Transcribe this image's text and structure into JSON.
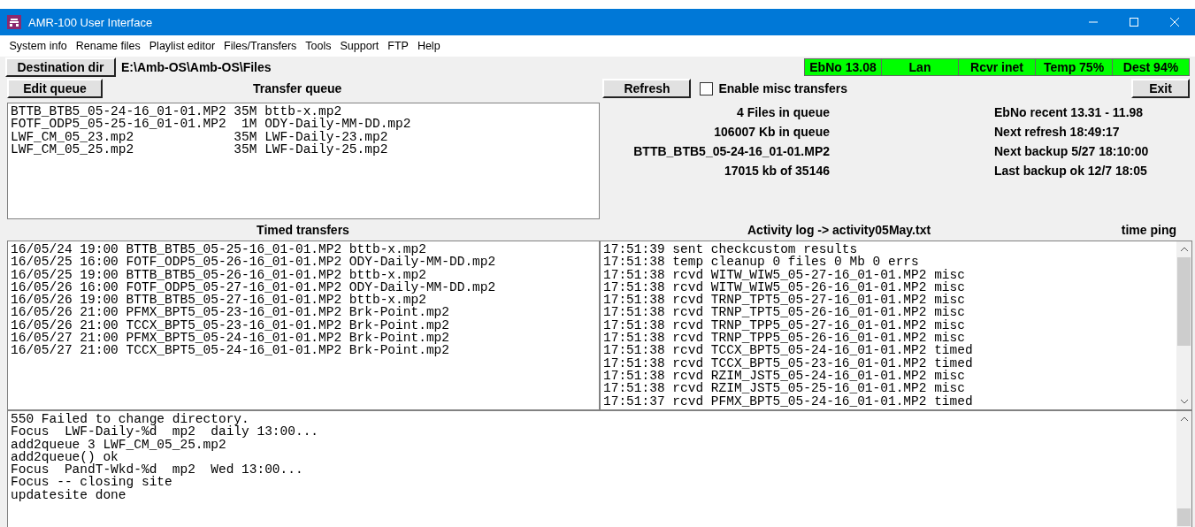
{
  "window": {
    "title": "AMR-100 User Interface"
  },
  "menu": [
    "System info",
    "Rename files",
    "Playlist editor",
    "Files/Transfers",
    "Tools",
    "Support",
    "FTP",
    "Help"
  ],
  "destination": {
    "button": "Destination dir",
    "path": "E:\\Amb-OS\\Amb-OS\\Files"
  },
  "status_bar": [
    "EbNo 13.08",
    "Lan",
    "Rcvr inet",
    "Temp 75%",
    "Dest 94%"
  ],
  "edit_queue_button": "Edit queue",
  "transfer_queue": {
    "title": "Transfer queue",
    "lines": [
      "BTTB_BTB5_05-24-16_01-01.MP2 35M bttb-x.mp2",
      "FOTF_ODP5_05-25-16_01-01.MP2  1M ODY-Daily-MM-DD.mp2",
      "LWF_CM_05_23.mp2             35M LWF-Daily-23.mp2",
      "LWF_CM_05_25.mp2             35M LWF-Daily-25.mp2"
    ]
  },
  "refresh_button": "Refresh",
  "misc_checkbox": {
    "label": "Enable misc transfers",
    "checked": false
  },
  "exit_button": "Exit",
  "queue_info": [
    "4 Files in queue",
    "106007 Kb in queue",
    "BTTB_BTB5_05-24-16_01-01.MP2",
    "17015 kb of 35146"
  ],
  "system_info": [
    "EbNo recent 13.31 - 11.98",
    "Next refresh 18:49:17",
    "Next backup 5/27 18:10:00",
    "Last backup ok 12/7 18:05"
  ],
  "timed_transfers": {
    "title": "Timed transfers",
    "lines": [
      "16/05/24 19:00 BTTB_BTB5_05-25-16_01-01.MP2 bttb-x.mp2",
      "16/05/25 16:00 FOTF_ODP5_05-26-16_01-01.MP2 ODY-Daily-MM-DD.mp2",
      "16/05/25 19:00 BTTB_BTB5_05-26-16_01-01.MP2 bttb-x.mp2",
      "16/05/26 16:00 FOTF_ODP5_05-27-16_01-01.MP2 ODY-Daily-MM-DD.mp2",
      "16/05/26 19:00 BTTB_BTB5_05-27-16_01-01.MP2 bttb-x.mp2",
      "16/05/26 21:00 PFMX_BPT5_05-23-16_01-01.MP2 Brk-Point.mp2",
      "16/05/26 21:00 TCCX_BPT5_05-23-16_01-01.MP2 Brk-Point.mp2",
      "16/05/27 21:00 PFMX_BPT5_05-24-16_01-01.MP2 Brk-Point.mp2",
      "16/05/27 21:00 TCCX_BPT5_05-24-16_01-01.MP2 Brk-Point.mp2"
    ]
  },
  "activity_log": {
    "title": "Activity log -> activity05May.txt",
    "side_label": "time ping",
    "lines": [
      "17:51:39 sent checkcustom results",
      "17:51:38 temp cleanup 0 files 0 Mb 0 errs",
      "17:51:38 rcvd WITW_WIW5_05-27-16_01-01.MP2 misc",
      "17:51:38 rcvd WITW_WIW5_05-26-16_01-01.MP2 misc",
      "17:51:38 rcvd TRNP_TPT5_05-27-16_01-01.MP2 misc",
      "17:51:38 rcvd TRNP_TPT5_05-26-16_01-01.MP2 misc",
      "17:51:38 rcvd TRNP_TPP5_05-27-16_01-01.MP2 misc",
      "17:51:38 rcvd TRNP_TPP5_05-26-16_01-01.MP2 misc",
      "17:51:38 rcvd TCCX_BPT5_05-24-16_01-01.MP2 timed",
      "17:51:38 rcvd TCCX_BPT5_05-23-16_01-01.MP2 timed",
      "17:51:38 rcvd RZIM_JST5_05-24-16_01-01.MP2 misc",
      "17:51:38 rcvd RZIM_JST5_05-25-16_01-01.MP2 misc",
      "17:51:37 rcvd PFMX_BPT5_05-24-16_01-01.MP2 timed"
    ]
  },
  "console": {
    "lines": [
      "550 Failed to change directory.",
      "Focus  LWF-Daily-%d  mp2  daily 13:00...",
      "add2queue 3 LWF_CM_05_25.mp2",
      "add2queue() ok",
      "Focus  PandT-Wkd-%d  mp2  Wed 13:00...",
      "Focus -- closing site",
      "updatesite done"
    ]
  }
}
